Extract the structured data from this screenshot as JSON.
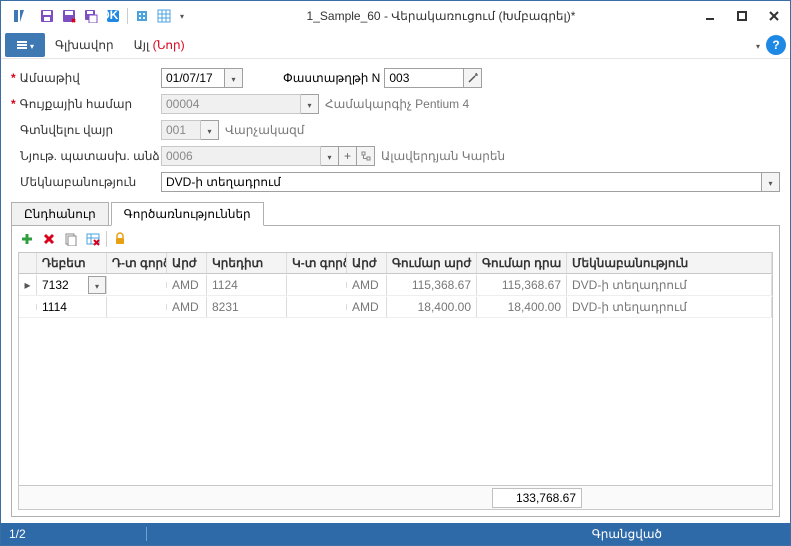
{
  "window": {
    "title": "1_Sample_60 - Վերակառուցում (Խմբագրել)*"
  },
  "menubar": {
    "main": "Գլխավոր",
    "other": "Այլ",
    "other_red": "(Նոր)"
  },
  "form": {
    "date_lbl": "Ամսաթիվ",
    "date_val": "01/07/17",
    "docnum_lbl": "Փաստաթղթի N",
    "docnum_val": "003",
    "asset_lbl": "Գույքային համար",
    "asset_val": "00004",
    "asset_sub": "Համակարգիչ Pentium 4",
    "loc_lbl": "Գտնվելու վայր",
    "loc_val": "001",
    "loc_sub": "Վարչակազմ",
    "resp_lbl": "Նյութ. պատասխ. անձ",
    "resp_val": "0006",
    "resp_sub": "Ալավերդյան Կարեն",
    "comment_lbl": "Մեկնաբանություն",
    "comment_val": "DVD-ի տեղադրում"
  },
  "tabs": {
    "general": "Ընդհանուր",
    "ops": "Գործառնություններ"
  },
  "grid": {
    "head": {
      "debet": "Դեբետ",
      "dt": "Դ-տ գործ",
      "arj1": "Արժ",
      "kredit": "Կրեդիտ",
      "kt": "Կ-տ գործ",
      "arj2": "Արժ",
      "sum1": "Գումար արժ",
      "sum2": "Գումար դրա",
      "comment": "Մեկնաբանություն"
    },
    "rows": [
      {
        "debet": "7132",
        "dt": "",
        "arj1": "AMD",
        "kredit": "1124",
        "kt": "",
        "arj2": "AMD",
        "sum1": "115,368.67",
        "sum2": "115,368.67",
        "comment": "DVD-ի տեղադրում"
      },
      {
        "debet": "1114",
        "dt": "",
        "arj1": "AMD",
        "kredit": "8231",
        "kt": "",
        "arj2": "AMD",
        "sum1": "18,400.00",
        "sum2": "18,400.00",
        "comment": "DVD-ի տեղադրում"
      }
    ],
    "total": "133,768.67"
  },
  "status": {
    "pos": "1/2",
    "state": "Գրանցված"
  }
}
